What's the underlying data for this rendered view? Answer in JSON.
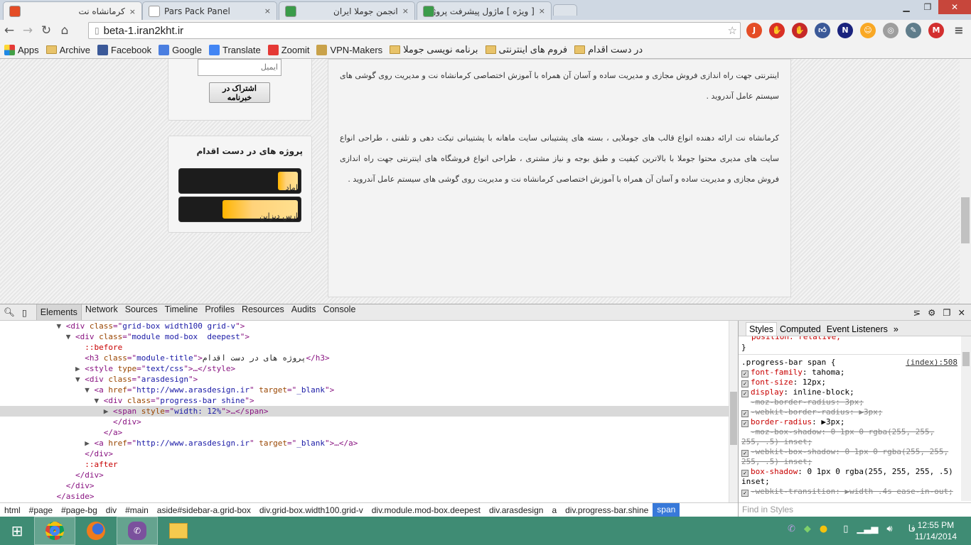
{
  "browser": {
    "tabs": [
      {
        "title": "کرمانشاه نت",
        "active": true,
        "icon": "joomla-icon"
      },
      {
        "title": "Pars Pack Panel",
        "active": false,
        "icon": "page-icon"
      },
      {
        "title": "انجمن جوملا ایران",
        "active": false,
        "icon": "forum-icon"
      },
      {
        "title": "[ ویژه ] ماژول پیشرفت پروژه",
        "active": false,
        "icon": "forum-icon"
      }
    ],
    "close_glyph": "×",
    "url": "beta-1.iran2kht.ir",
    "extensions": [
      "joomla-6-icon",
      "adblock-icon",
      "stop-icon",
      "facebook-like-icon",
      "screenshot-icon",
      "emoji-icon",
      "globe-icon",
      "eyedropper-icon",
      "gmail-icon",
      "menu-icon"
    ],
    "bookmarks": [
      {
        "label": "Apps",
        "icon": "apps-icon"
      },
      {
        "label": "Archive",
        "icon": "folder-icon"
      },
      {
        "label": "Facebook",
        "icon": "facebook-icon"
      },
      {
        "label": "Google",
        "icon": "google-icon"
      },
      {
        "label": "Translate",
        "icon": "translate-icon"
      },
      {
        "label": "Zoomit",
        "icon": "zoomit-icon"
      },
      {
        "label": "VPN-Makers",
        "icon": "vpn-icon"
      },
      {
        "label": "برنامه نویسی جوملا",
        "icon": "folder-icon"
      },
      {
        "label": "فروم های اینترنتی",
        "icon": "folder-icon"
      },
      {
        "label": "در دست اقدام",
        "icon": "folder-icon"
      }
    ]
  },
  "page": {
    "newsletter": {
      "email_placeholder": "ایمیل",
      "subscribe_label": "اشتراک در خبرنامه"
    },
    "projects": {
      "title": "پروژه های در دست اقدام",
      "items": [
        {
          "label": "اماد",
          "progress_percent": 12
        },
        {
          "label": "ارس دیزاین",
          "progress_percent": 65
        }
      ]
    },
    "paragraphs": [
      "اینترنتی جهت راه اندازی فروش مجازی و مدیریت ساده و آسان آن همراه با آموزش اختصاصی کرمانشاه نت و مدیریت روی گوشی های سیستم عامل آندروید .",
      "کرمانشاه نت ارائه دهنده انواع قالب های جوملایی ، بسته های پشتیبانی سایت ماهانه با پشتیبانی تیکت دهی و تلفنی ، طراحی انواع سایت های مدیری محتوا جوملا با بالاترین کیفیت و طبق بوجه و نیاز مشتری ، طراحی انواع فروشگاه های اینترنتی جهت راه اندازی فروش مجازی و مدیریت ساده و آسان آن همراه با آموزش اختصاصی کرمانشاه نت و مدیریت روی گوشی های سیستم عامل آندروید ."
    ]
  },
  "devtools": {
    "tabs": [
      "Elements",
      "Network",
      "Sources",
      "Timeline",
      "Profiles",
      "Resources",
      "Audits",
      "Console"
    ],
    "active_tab": "Elements",
    "dom": [
      {
        "indent": 7,
        "arrow": "▼",
        "parts": [
          [
            "tg",
            "<div "
          ],
          [
            "at",
            "class"
          ],
          [
            "tg",
            "=\""
          ],
          [
            "av",
            "grid-box width100 grid-v"
          ],
          [
            "tg",
            "\">"
          ]
        ]
      },
      {
        "indent": 8,
        "arrow": "▼",
        "parts": [
          [
            "tg",
            "<div "
          ],
          [
            "at",
            "class"
          ],
          [
            "tg",
            "=\""
          ],
          [
            "av",
            "module mod-box  deepest"
          ],
          [
            "tg",
            "\">"
          ]
        ]
      },
      {
        "indent": 9,
        "arrow": " ",
        "parts": [
          [
            "ps",
            "::before"
          ]
        ]
      },
      {
        "indent": 9,
        "arrow": " ",
        "parts": [
          [
            "tg",
            "<h3 "
          ],
          [
            "at",
            "class"
          ],
          [
            "tg",
            "=\""
          ],
          [
            "av",
            "module-title"
          ],
          [
            "tg",
            "\">"
          ],
          [
            "tx",
            "پروژه های در دست اقدام"
          ],
          [
            "tg",
            "</h3>"
          ]
        ]
      },
      {
        "indent": 9,
        "arrow": "▶",
        "parts": [
          [
            "tg",
            "<style "
          ],
          [
            "at",
            "type"
          ],
          [
            "tg",
            "=\""
          ],
          [
            "av",
            "text/css"
          ],
          [
            "tg",
            "\">…</style>"
          ]
        ]
      },
      {
        "indent": 9,
        "arrow": "▼",
        "parts": [
          [
            "tg",
            "<div "
          ],
          [
            "at",
            "class"
          ],
          [
            "tg",
            "=\""
          ],
          [
            "av",
            "arasdesign"
          ],
          [
            "tg",
            "\">"
          ]
        ]
      },
      {
        "indent": 10,
        "arrow": "▼",
        "parts": [
          [
            "tg",
            "<a "
          ],
          [
            "at",
            "href"
          ],
          [
            "tg",
            "=\""
          ],
          [
            "av",
            "http://www.arasdesign.ir"
          ],
          [
            "tg",
            "\" "
          ],
          [
            "at",
            "target"
          ],
          [
            "tg",
            "=\""
          ],
          [
            "av",
            "_blank"
          ],
          [
            "tg",
            "\">"
          ]
        ]
      },
      {
        "indent": 11,
        "arrow": "▼",
        "parts": [
          [
            "tg",
            "<div "
          ],
          [
            "at",
            "class"
          ],
          [
            "tg",
            "=\""
          ],
          [
            "av",
            "progress-bar shine"
          ],
          [
            "tg",
            "\">"
          ]
        ]
      },
      {
        "indent": 12,
        "arrow": "▶",
        "hl": true,
        "parts": [
          [
            "tg",
            "<span "
          ],
          [
            "at",
            "style"
          ],
          [
            "tg",
            "=\""
          ],
          [
            "av",
            "width: 12%"
          ],
          [
            "tg",
            "\">…</span>"
          ]
        ]
      },
      {
        "indent": 12,
        "arrow": " ",
        "parts": [
          [
            "tg",
            "</div>"
          ]
        ]
      },
      {
        "indent": 11,
        "arrow": " ",
        "parts": [
          [
            "tg",
            "</a>"
          ]
        ]
      },
      {
        "indent": 10,
        "arrow": "▶",
        "parts": [
          [
            "tg",
            "<a "
          ],
          [
            "at",
            "href"
          ],
          [
            "tg",
            "=\""
          ],
          [
            "av",
            "http://www.arasdesign.ir"
          ],
          [
            "tg",
            "\" "
          ],
          [
            "at",
            "target"
          ],
          [
            "tg",
            "=\""
          ],
          [
            "av",
            "_blank"
          ],
          [
            "tg",
            "\">…</a>"
          ]
        ]
      },
      {
        "indent": 9,
        "arrow": " ",
        "parts": [
          [
            "tg",
            "</div>"
          ]
        ]
      },
      {
        "indent": 9,
        "arrow": " ",
        "parts": [
          [
            "ps",
            "::after"
          ]
        ]
      },
      {
        "indent": 8,
        "arrow": " ",
        "parts": [
          [
            "tg",
            "</div>"
          ]
        ]
      },
      {
        "indent": 7,
        "arrow": " ",
        "parts": [
          [
            "tg",
            "</div>"
          ]
        ]
      },
      {
        "indent": 6,
        "arrow": " ",
        "parts": [
          [
            "tg",
            "</aside>"
          ]
        ]
      }
    ],
    "breadcrumbs": [
      "html",
      "#page",
      "#page-bg",
      "div",
      "#main",
      "aside#sidebar-a.grid-box",
      "div.grid-box.width100.grid-v",
      "div.module.mod-box.deepest",
      "div.arasdesign",
      "a",
      "div.progress-bar.shine",
      "span"
    ],
    "styles_tabs": [
      "Styles",
      "Computed",
      "Event Listeners",
      "»"
    ],
    "rule_prev_tail": "position: relative;",
    "rule_selector": ".progress-bar span {",
    "rule_source": "(index):508",
    "declarations": [
      {
        "check": true,
        "struck": false,
        "prop": "font-family",
        "value": "tahoma;"
      },
      {
        "check": true,
        "struck": false,
        "prop": "font-size",
        "value": "12px;"
      },
      {
        "check": true,
        "struck": false,
        "prop": "display",
        "value": "inline-block;"
      },
      {
        "check": false,
        "struck": true,
        "prop": "-moz-border-radius",
        "value": "3px;"
      },
      {
        "check": true,
        "struck": true,
        "prop": "-webkit-border-radius",
        "value": "▶3px;"
      },
      {
        "check": true,
        "struck": false,
        "prop": "border-radius",
        "value": "▶3px;"
      },
      {
        "check": false,
        "struck": true,
        "prop": "-moz-box-shadow",
        "value": "0 1px 0 rgba(255, 255, 255, .5) inset;"
      },
      {
        "check": true,
        "struck": true,
        "prop": "-webkit-box-shadow",
        "value": "0 1px 0 rgba(255, 255, 255, .5) inset;"
      },
      {
        "check": true,
        "struck": false,
        "prop": "box-shadow",
        "value": "0 1px 0 rgba(255, 255, 255, .5) inset;"
      },
      {
        "check": true,
        "struck": true,
        "prop": "-webkit-transition",
        "value": "▶width .4s ease-in-out;"
      }
    ],
    "find_placeholder": "Find in Styles"
  },
  "taskbar": {
    "apps": [
      "windows-start-icon",
      "chrome-icon",
      "firefox-icon",
      "viber-icon",
      "file-explorer-icon"
    ],
    "tray": [
      "viber-icon",
      "idm-icon",
      "chrome-icon",
      "battery-icon",
      "signal-icon",
      "volume-icon"
    ],
    "language": "فا",
    "time": "12:55 PM",
    "date": "11/14/2014"
  },
  "colors": {
    "taskbar": "#3f8c74",
    "progress_fill": "#ffb400",
    "selected_crumb": "#3879d9",
    "close_button": "#c7463b"
  }
}
